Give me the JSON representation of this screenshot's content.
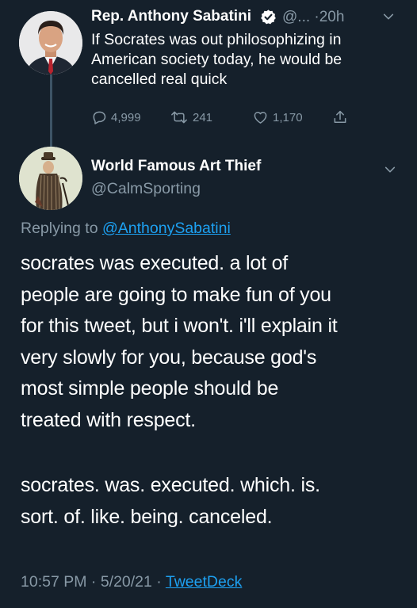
{
  "colors": {
    "background": "#15202b",
    "text": "#ffffff",
    "muted": "#8899a6",
    "link": "#1da1f2",
    "thread_line": "#3d5466"
  },
  "parent_tweet": {
    "author_name": "Rep. Anthony Sabatini",
    "verified": true,
    "handle_truncated": "@...",
    "separator": "·",
    "time_ago": "20h",
    "text_lines": [
      "If Socrates was out philosophizing in",
      "American society today, he would be",
      "cancelled real quick"
    ],
    "actions": {
      "replies": "4,999",
      "retweets": "241",
      "likes": "1,170"
    },
    "icons": [
      "verified-badge-icon",
      "chevron-down-icon",
      "reply-icon",
      "retweet-icon",
      "like-icon",
      "share-icon"
    ]
  },
  "reply_tweet": {
    "author_name": "World Famous Art Thief",
    "handle": "@CalmSporting",
    "replying_prefix": "Replying to",
    "replying_handle": "@AnthonySabatini",
    "paragraph1_lines": [
      "socrates was executed. a lot of",
      "people are going to make fun of you",
      "for this tweet, but i won't. i'll explain it",
      "very slowly for you, because god's",
      "most simple people should be",
      "treated with respect."
    ],
    "paragraph2_lines": [
      "socrates. was. executed. which. is.",
      "sort. of. like. being. canceled."
    ],
    "timestamp_time": "10:57 PM",
    "timestamp_date": "5/20/21",
    "timestamp_sep1": "·",
    "timestamp_sep2": "·",
    "source": "TweetDeck"
  }
}
